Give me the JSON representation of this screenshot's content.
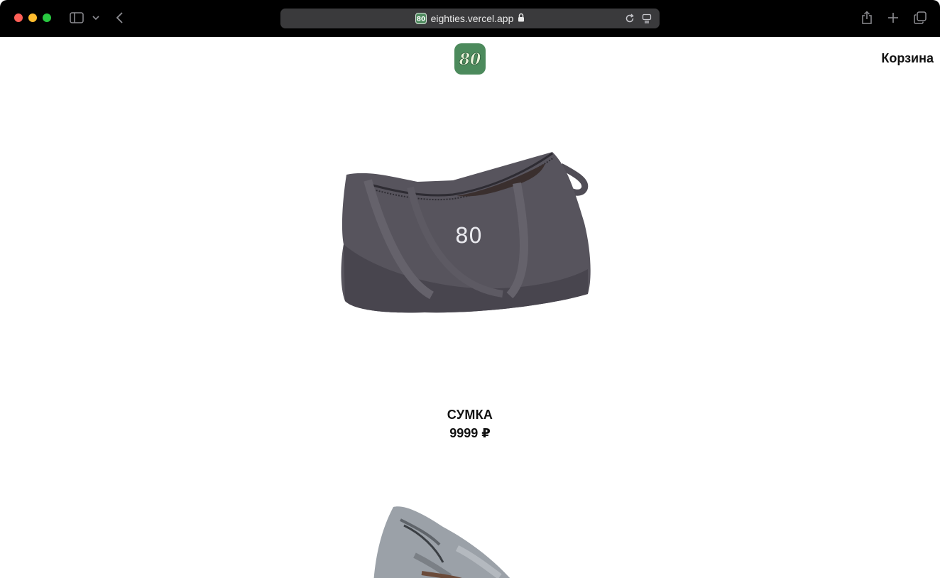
{
  "browser": {
    "url": "eighties.vercel.app",
    "favicon_text": "80",
    "icons": [
      "sidebar-icon",
      "chevron-down-icon",
      "back-icon",
      "lock-icon",
      "reload-icon",
      "reader-icon",
      "share-icon",
      "plus-icon",
      "tabs-icon"
    ]
  },
  "header": {
    "logo_text": "80",
    "cart_label": "Корзина"
  },
  "products": [
    {
      "image_text": "80",
      "title": "СУМКА",
      "price": "9999 ₽",
      "image": "dark-grey-duffel-bag"
    },
    {
      "image": "light-grey-bag"
    }
  ],
  "colors": {
    "brand_green": "#4c8a5c",
    "toolbar_bg": "#000000",
    "urlbar_bg": "#3a3a3c"
  }
}
